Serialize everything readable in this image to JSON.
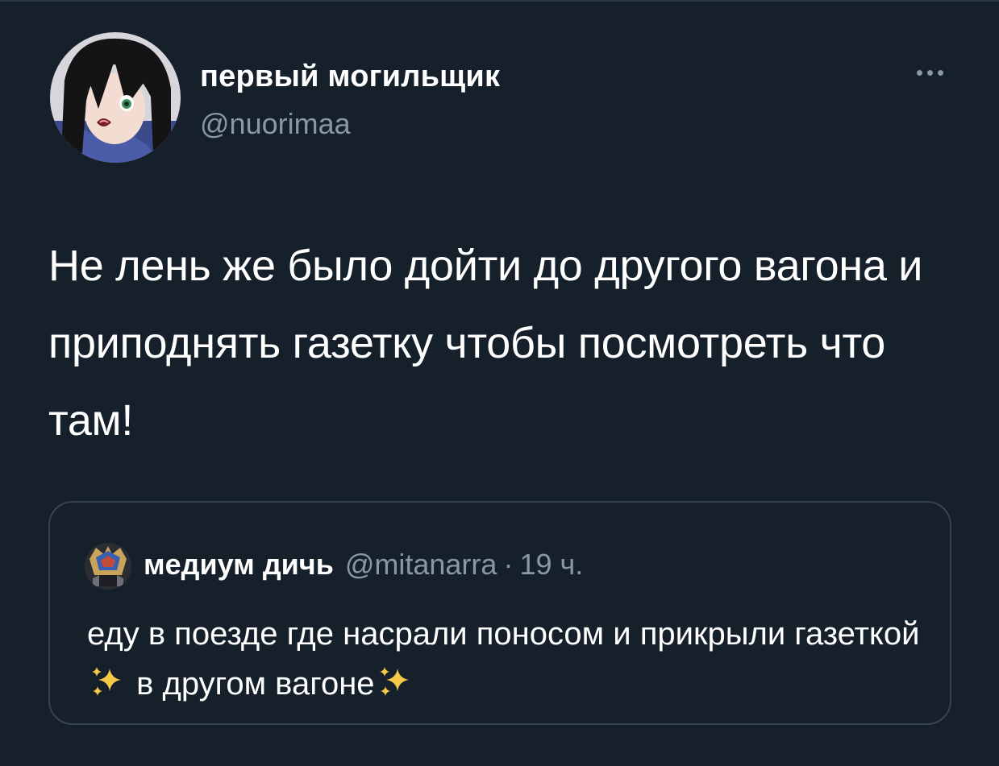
{
  "tweet": {
    "author_name": "первый могильщик",
    "author_handle": "@nuorimaa",
    "text": "Не лень же было дойти до другого вагона и приподнять газетку чтобы посмотреть что там!",
    "more_icon": "more-horizontal-icon"
  },
  "quote": {
    "author_name": "медиум дичь",
    "author_handle": "@mitanarra",
    "separator": "·",
    "time": "19 ч.",
    "text_part1": "еду в поезде где насрали поносом и прикрыли газеткой ",
    "text_part2": " в другом вагоне",
    "emoji": "sparkles-icon"
  },
  "colors": {
    "background": "#15202b",
    "border": "#38444d",
    "secondary_text": "#8899a6",
    "primary_text": "#ffffff"
  }
}
